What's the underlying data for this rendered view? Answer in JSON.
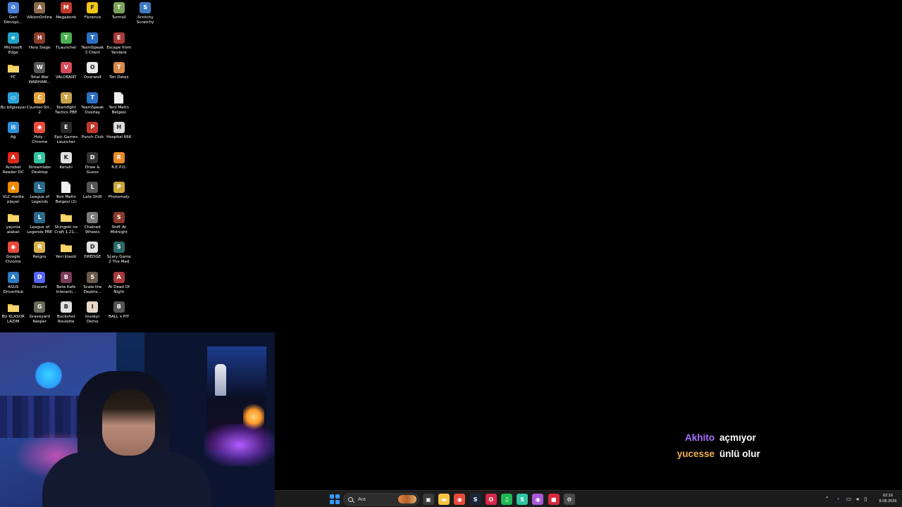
{
  "desktop": {
    "icons": [
      {
        "label": "Geri Dönüşü...",
        "icon": "recycle-bin-icon",
        "color": "#4a7fd6",
        "glyph": "♻"
      },
      {
        "label": "AlbionOnline",
        "icon": "albion-online-icon",
        "color": "#8a6a4a",
        "glyph": "A"
      },
      {
        "label": "Megabonk",
        "icon": "megabonk-icon",
        "color": "#c0392b",
        "glyph": "M"
      },
      {
        "label": "Florence",
        "icon": "florence-icon",
        "color": "#f1c40f",
        "glyph": "F"
      },
      {
        "label": "Turmoil",
        "icon": "turmoil-icon",
        "color": "#7aa35a",
        "glyph": "T"
      },
      {
        "label": "Scritchy Scratchy",
        "icon": "scritchy-scratchy-icon",
        "color": "#3e7bbf",
        "glyph": "S"
      },
      {
        "label": "Microsoft Edge",
        "icon": "microsoft-edge-icon",
        "color": "#1fa3c7",
        "glyph": "e"
      },
      {
        "label": "Hero Siege",
        "icon": "hero-siege-icon",
        "color": "#8b3a2a",
        "glyph": "H"
      },
      {
        "label": "TLauncher",
        "icon": "tlauncher-icon",
        "color": "#4caf50",
        "glyph": "T"
      },
      {
        "label": "TeamSpeak 3 Client",
        "icon": "teamspeak-icon",
        "color": "#2c6fc2",
        "glyph": "T"
      },
      {
        "label": "Escape from Yandere",
        "icon": "escape-from-yandere-icon",
        "color": "#a83a3a",
        "glyph": "E"
      },
      {
        "label": "",
        "icon": "",
        "color": "",
        "glyph": ""
      },
      {
        "label": "PC",
        "icon": "folder-icon",
        "color": "#f4c542",
        "glyph": ""
      },
      {
        "label": "Total War WARHAM...",
        "icon": "total-war-warhammer-icon",
        "color": "#555",
        "glyph": "W"
      },
      {
        "label": "VALORANT",
        "icon": "valorant-icon",
        "color": "#d84a5a",
        "glyph": "V"
      },
      {
        "label": "Overwolf",
        "icon": "overwolf-icon",
        "color": "#e8e8e8",
        "glyph": "O"
      },
      {
        "label": "Ten Dates",
        "icon": "ten-dates-icon",
        "color": "#d8894a",
        "glyph": "T"
      },
      {
        "label": "",
        "icon": "",
        "color": "",
        "glyph": ""
      },
      {
        "label": "Bu bilgisayar",
        "icon": "this-pc-icon",
        "color": "#2aa3d8",
        "glyph": "▭"
      },
      {
        "label": "Counter-Str... 2",
        "icon": "counter-strike-icon",
        "color": "#e8a23a",
        "glyph": "C"
      },
      {
        "label": "Teamfight Tactics PBE",
        "icon": "teamfight-tactics-icon",
        "color": "#c9a24a",
        "glyph": "T"
      },
      {
        "label": "TeamSpeak Overlay",
        "icon": "teamspeak-overlay-icon",
        "color": "#2c6fc2",
        "glyph": "T"
      },
      {
        "label": "Yeni Metin Belgesi",
        "icon": "text-document-icon",
        "color": "#f0f0f0",
        "glyph": ""
      },
      {
        "label": "",
        "icon": "",
        "color": "",
        "glyph": ""
      },
      {
        "label": "Ağ",
        "icon": "network-icon",
        "color": "#2a8fd8",
        "glyph": "⊞"
      },
      {
        "label": "Holy - Chrome",
        "icon": "chrome-icon",
        "color": "#e84a3a",
        "glyph": "◉"
      },
      {
        "label": "Epic Games Launcher",
        "icon": "epic-games-icon",
        "color": "#2a2a2a",
        "glyph": "E"
      },
      {
        "label": "Punch Club",
        "icon": "punch-club-icon",
        "color": "#c0392b",
        "glyph": "P"
      },
      {
        "label": "Hospital 666",
        "icon": "hospital-666-icon",
        "color": "#dcdcdc",
        "glyph": "H"
      },
      {
        "label": "",
        "icon": "",
        "color": "",
        "glyph": ""
      },
      {
        "label": "Acrobat Reader DC",
        "icon": "acrobat-reader-icon",
        "color": "#d8281a",
        "glyph": "A"
      },
      {
        "label": "Streamlabs Desktop",
        "icon": "streamlabs-icon",
        "color": "#31c3a2",
        "glyph": "S"
      },
      {
        "label": "Kenshi",
        "icon": "kenshi-icon",
        "color": "#e0e0e0",
        "glyph": "K"
      },
      {
        "label": "Draw & Guess",
        "icon": "draw-and-guess-icon",
        "color": "#333",
        "glyph": "D"
      },
      {
        "label": "R.E.P.O.",
        "icon": "repo-icon",
        "color": "#e88a2a",
        "glyph": "R"
      },
      {
        "label": "",
        "icon": "",
        "color": "",
        "glyph": ""
      },
      {
        "label": "VLC media player",
        "icon": "vlc-icon",
        "color": "#f08a00",
        "glyph": "▲"
      },
      {
        "label": "League of Legends",
        "icon": "league-of-legends-icon",
        "color": "#2a6a8a",
        "glyph": "L"
      },
      {
        "label": "Yeni Metin Belgesi (2)",
        "icon": "text-document-icon",
        "color": "#f0f0f0",
        "glyph": ""
      },
      {
        "label": "Late Shift",
        "icon": "late-shift-icon",
        "color": "#555",
        "glyph": "L"
      },
      {
        "label": "Photomaly",
        "icon": "photomaly-icon",
        "color": "#c9a83a",
        "glyph": "P"
      },
      {
        "label": "",
        "icon": "",
        "color": "",
        "glyph": ""
      },
      {
        "label": "yayınla alakalı",
        "icon": "folder-icon",
        "color": "#f4c542",
        "glyph": ""
      },
      {
        "label": "League of Legends PBE",
        "icon": "league-of-legends-pbe-icon",
        "color": "#2a6a8a",
        "glyph": "L"
      },
      {
        "label": "Shingeki no Craft 1.21...",
        "icon": "folder-icon",
        "color": "#f4c542",
        "glyph": ""
      },
      {
        "label": "Chained Wheels",
        "icon": "chained-wheels-icon",
        "color": "#7a7a7a",
        "glyph": "C"
      },
      {
        "label": "Shift At Midnight",
        "icon": "shift-at-midnight-icon",
        "color": "#8a3a2a",
        "glyph": "S"
      },
      {
        "label": "",
        "icon": "",
        "color": "",
        "glyph": ""
      },
      {
        "label": "Google Chrome",
        "icon": "chrome-icon",
        "color": "#e84a3a",
        "glyph": "◉"
      },
      {
        "label": "Reigns",
        "icon": "reigns-icon",
        "color": "#d8b04a",
        "glyph": "R"
      },
      {
        "label": "Yeni klasör",
        "icon": "folder-icon",
        "color": "#f4c542",
        "glyph": ""
      },
      {
        "label": "DREDGE",
        "icon": "dredge-icon",
        "color": "#e0e0e0",
        "glyph": "D"
      },
      {
        "label": "Scary Game 2 The Mad S...",
        "icon": "scary-game-2-icon",
        "color": "#2a6a6a",
        "glyph": "S"
      },
      {
        "label": "",
        "icon": "",
        "color": "",
        "glyph": ""
      },
      {
        "label": "ASUS DriverHub",
        "icon": "asus-driverhub-icon",
        "color": "#2a7ac2",
        "glyph": "A"
      },
      {
        "label": "Discord",
        "icon": "discord-icon",
        "color": "#5865f2",
        "glyph": "D"
      },
      {
        "label": "Beta Kafe Interacti...",
        "icon": "beta-kafe-icon",
        "color": "#7a3a5a",
        "glyph": "B"
      },
      {
        "label": "Scale the Depths...",
        "icon": "scale-the-depths-icon",
        "color": "#6a5a4a",
        "glyph": "S"
      },
      {
        "label": "At Dead Of Night",
        "icon": "at-dead-of-night-icon",
        "color": "#a83a3a",
        "glyph": "A"
      },
      {
        "label": "",
        "icon": "",
        "color": "",
        "glyph": ""
      },
      {
        "label": "BU KLASÖR LAZIM",
        "icon": "folder-icon",
        "color": "#f4c542",
        "glyph": ""
      },
      {
        "label": "Graveyard Keeper",
        "icon": "graveyard-keeper-icon",
        "color": "#6a6a5a",
        "glyph": "G"
      },
      {
        "label": "Buckshot Roulette",
        "icon": "buckshot-roulette-icon",
        "color": "#e0e0e0",
        "glyph": "B"
      },
      {
        "label": "Invokyr Demo",
        "icon": "invokyr-icon",
        "color": "#e8d8c8",
        "glyph": "I"
      },
      {
        "label": "BALL x PIT",
        "icon": "ball-x-pit-icon",
        "color": "#555",
        "glyph": "B"
      },
      {
        "label": "",
        "icon": "",
        "color": "",
        "glyph": ""
      }
    ]
  },
  "chat": {
    "lines": [
      {
        "user": "Akhito",
        "user_color": "#a970ff",
        "message": "açmıyor"
      },
      {
        "user": "yucesse",
        "user_color": "#f0b050",
        "message": "ünlü olur"
      }
    ]
  },
  "taskbar": {
    "search_placeholder": "Ara",
    "pinned": [
      {
        "name": "task-view-icon",
        "color": "#3a3a3a",
        "glyph": "▣"
      },
      {
        "name": "file-explorer-icon",
        "color": "#f4c542",
        "glyph": "▬"
      },
      {
        "name": "chrome-icon",
        "color": "#e84a3a",
        "glyph": "◉"
      },
      {
        "name": "steam-icon",
        "color": "#1b2838",
        "glyph": "S"
      },
      {
        "name": "opera-gx-icon",
        "color": "#d8284a",
        "glyph": "O"
      },
      {
        "name": "spotify-icon",
        "color": "#1db954",
        "glyph": "♫"
      },
      {
        "name": "streamlabs-icon",
        "color": "#31c3a2",
        "glyph": "S"
      },
      {
        "name": "chrome-profile-icon",
        "color": "#a85ad8",
        "glyph": "◉"
      },
      {
        "name": "app-red-icon",
        "color": "#d8283a",
        "glyph": "■"
      },
      {
        "name": "settings-icon",
        "color": "#4a4a4a",
        "glyph": "⚙"
      }
    ],
    "clock_time": "02:16",
    "clock_date": "8.08.2026"
  }
}
